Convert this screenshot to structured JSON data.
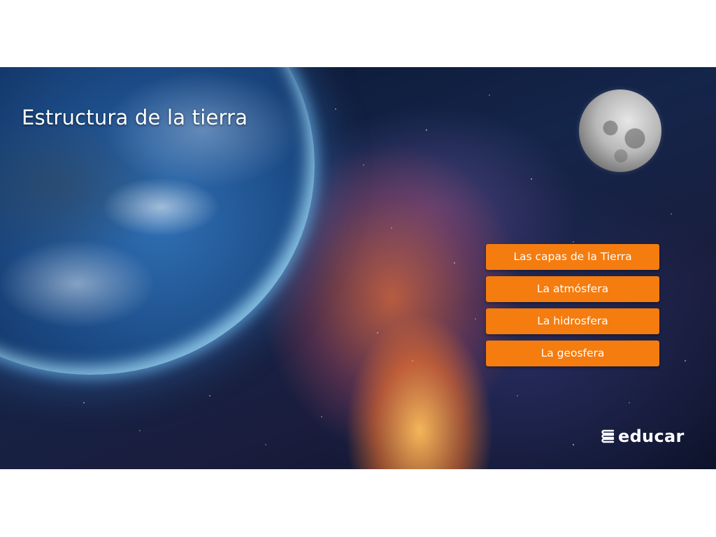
{
  "slide": {
    "title": "Estructura de la tierra"
  },
  "menu": {
    "items": [
      {
        "label": "Las capas de la Tierra"
      },
      {
        "label": "La atmósfera"
      },
      {
        "label": "La hidrosfera"
      },
      {
        "label": "La geosfera"
      }
    ]
  },
  "brand": {
    "logo_text": "educar",
    "accent_color": "#f57c0f"
  },
  "icons": {
    "logo": "educar-logo-icon"
  }
}
